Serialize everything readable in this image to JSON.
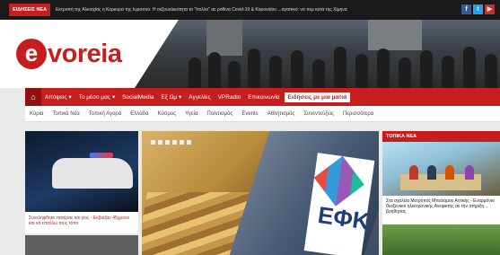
{
  "ticker": {
    "label": "ΕΙΔΗΣΕΙΣ ΝΕΑ",
    "text": "Εκτροπή της Αλκιοχίας η Κορκυρα της Ιερισσού: Η σεξουαλικότητα το \"Ιτολλα\" σε ρόθινα Covid-19 & Κοροναϊου ...αγαπικό: να περ κατά της Χίμηνα"
  },
  "header": {
    "logo_letter": "e",
    "logo_text": "voreia"
  },
  "nav": {
    "items": [
      "Απόψεις ▾",
      "Το μέσο μας ▾",
      "SocialMedia",
      "Εξ Ωμ ▾",
      "Αγγελίες",
      "VPRadio",
      "Επικοινωνία"
    ],
    "active": "Ειδήσεις με μια ματιά"
  },
  "subnav": {
    "items": [
      "Κύρια",
      "Τοπικά Νέα",
      "Τοπική Αγορά",
      "Ελλάδα",
      "Κόσμος",
      "Υγεία",
      "Πολιτισμός",
      "Events",
      "Αθλητισμός",
      "Συνεντεύξεις",
      "Περισσότερα"
    ]
  },
  "left_card": {
    "caption": "Συνελήφθηκε πατέρας και γιος - Εκβιάζαν 45χρονο και να επιτέλω τους τόπο"
  },
  "side": {
    "header": "ΤΟΠΙΚΑ ΝΕΑ",
    "caption": "Στα σχολεία Μετρόπος Μπαλάμου Αττικής - Εναρμόνιο θεοξενικοί ηλεκτρονικής Ανεφικτής σε την στήριξη... βοήθησας"
  }
}
